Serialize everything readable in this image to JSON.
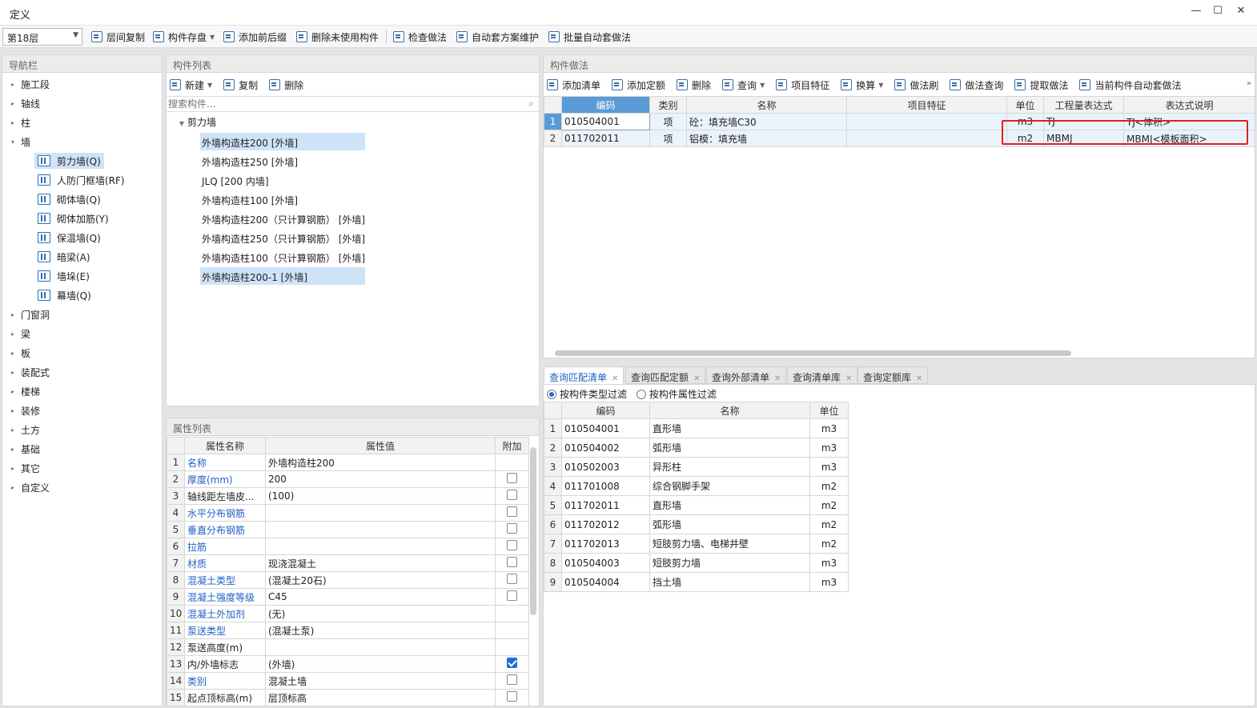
{
  "window": {
    "title": "定义",
    "min": "—",
    "max": "☐",
    "close": "✕"
  },
  "toolbar": {
    "floor": "第18层",
    "buttons": [
      "层间复制",
      "构件存盘",
      "添加前后缀",
      "删除未使用构件",
      "检查做法",
      "自动套方案维护",
      "批量自动套做法"
    ]
  },
  "nav": {
    "title": "导航栏",
    "items": [
      {
        "label": "施工段",
        "level": 0,
        "open": false
      },
      {
        "label": "轴线",
        "level": 0,
        "open": false
      },
      {
        "label": "柱",
        "level": 0,
        "open": false
      },
      {
        "label": "墙",
        "level": 0,
        "open": true
      },
      {
        "label": "剪力墙(Q)",
        "level": 1,
        "icon": "shear-wall-icon"
      },
      {
        "label": "人防门框墙(RF)",
        "level": 1,
        "icon": "door-frame-wall-icon"
      },
      {
        "label": "砌体墙(Q)",
        "level": 1,
        "icon": "masonry-wall-icon"
      },
      {
        "label": "砌体加筋(Y)",
        "level": 1,
        "icon": "masonry-rebar-icon"
      },
      {
        "label": "保温墙(Q)",
        "level": 1,
        "icon": "insulation-wall-icon"
      },
      {
        "label": "暗梁(A)",
        "level": 1,
        "icon": "hidden-beam-icon"
      },
      {
        "label": "墙垛(E)",
        "level": 1,
        "icon": "wall-pier-icon"
      },
      {
        "label": "幕墙(Q)",
        "level": 1,
        "icon": "curtain-wall-icon"
      },
      {
        "label": "门窗洞",
        "level": 0,
        "open": false
      },
      {
        "label": "梁",
        "level": 0,
        "open": false
      },
      {
        "label": "板",
        "level": 0,
        "open": false
      },
      {
        "label": "装配式",
        "level": 0,
        "open": false
      },
      {
        "label": "楼梯",
        "level": 0,
        "open": false
      },
      {
        "label": "装修",
        "level": 0,
        "open": false
      },
      {
        "label": "土方",
        "level": 0,
        "open": false
      },
      {
        "label": "基础",
        "level": 0,
        "open": false
      },
      {
        "label": "其它",
        "level": 0,
        "open": false
      },
      {
        "label": "自定义",
        "level": 0,
        "open": false
      }
    ]
  },
  "complist": {
    "title": "构件列表",
    "new": "新建",
    "copy": "复制",
    "delete": "删除",
    "search_placeholder": "搜索构件...",
    "group": "剪力墙",
    "items": [
      "外墙构造柱200 [外墙]",
      "外墙构造柱250 [外墙]",
      "JLQ [200 内墙]",
      "外墙构造柱100 [外墙]",
      "外墙构造柱200（只计算钢筋） [外墙]",
      "外墙构造柱250（只计算钢筋） [外墙]",
      "外墙构造柱100（只计算钢筋） [外墙]",
      "外墙构造柱200-1 [外墙]"
    ]
  },
  "props": {
    "title": "属性列表",
    "headers": [
      "属性名称",
      "属性值",
      "附加"
    ],
    "rows": [
      {
        "n": "1",
        "name": "名称",
        "val": "外墙构造柱200",
        "blue": true,
        "cb": null
      },
      {
        "n": "2",
        "name": "厚度(mm)",
        "val": "200",
        "blue": true,
        "cb": false
      },
      {
        "n": "3",
        "name": "轴线距左墙皮...",
        "val": "(100)",
        "blue": false,
        "cb": false
      },
      {
        "n": "4",
        "name": "水平分布钢筋",
        "val": "",
        "blue": true,
        "cb": false
      },
      {
        "n": "5",
        "name": "垂直分布钢筋",
        "val": "",
        "blue": true,
        "cb": false
      },
      {
        "n": "6",
        "name": "拉筋",
        "val": "",
        "blue": true,
        "cb": false
      },
      {
        "n": "7",
        "name": "材质",
        "val": "现浇混凝土",
        "blue": true,
        "cb": false
      },
      {
        "n": "8",
        "name": "混凝土类型",
        "val": "(混凝土20石)",
        "blue": true,
        "cb": false
      },
      {
        "n": "9",
        "name": "混凝土强度等级",
        "val": "C45",
        "blue": true,
        "cb": false
      },
      {
        "n": "10",
        "name": "混凝土外加剂",
        "val": "(无)",
        "blue": true,
        "cb": null
      },
      {
        "n": "11",
        "name": "泵送类型",
        "val": "(混凝土泵)",
        "blue": true,
        "cb": null
      },
      {
        "n": "12",
        "name": "泵送高度(m)",
        "val": "",
        "blue": false,
        "cb": null
      },
      {
        "n": "13",
        "name": "内/外墙标志",
        "val": "(外墙)",
        "blue": false,
        "cb": true
      },
      {
        "n": "14",
        "name": "类别",
        "val": "混凝土墙",
        "blue": true,
        "cb": false
      },
      {
        "n": "15",
        "name": "起点顶标高(m)",
        "val": "层顶标高",
        "blue": false,
        "cb": false
      }
    ]
  },
  "method": {
    "title": "构件做法",
    "tools": [
      "添加清单",
      "添加定额",
      "删除",
      "查询",
      "项目特征",
      "换算",
      "做法刷",
      "做法查询",
      "提取做法",
      "当前构件自动套做法"
    ],
    "headers": [
      "编码",
      "类别",
      "名称",
      "项目特征",
      "单位",
      "工程量表达式",
      "表达式说明"
    ],
    "rows": [
      {
        "n": "1",
        "code": "010504001",
        "cat": "项",
        "name": "砼：填充墙C30",
        "feat": "",
        "unit": "m3",
        "expr": "TJ",
        "desc": "TJ<体积>"
      },
      {
        "n": "2",
        "code": "011702011",
        "cat": "项",
        "name": "铝模：填充墙",
        "feat": "",
        "unit": "m2",
        "expr": "MBMJ",
        "desc": "MBMJ<模板面积>"
      }
    ]
  },
  "tabs": [
    "查询匹配清单",
    "查询匹配定额",
    "查询外部清单",
    "查询清单库",
    "查询定额库"
  ],
  "filter": {
    "opt1": "按构件类型过滤",
    "opt2": "按构件属性过滤"
  },
  "match": {
    "headers": [
      "编码",
      "名称",
      "单位"
    ],
    "rows": [
      {
        "n": "1",
        "code": "010504001",
        "name": "直形墙",
        "unit": "m3"
      },
      {
        "n": "2",
        "code": "010504002",
        "name": "弧形墙",
        "unit": "m3"
      },
      {
        "n": "3",
        "code": "010502003",
        "name": "异形柱",
        "unit": "m3"
      },
      {
        "n": "4",
        "code": "011701008",
        "name": "综合钢脚手架",
        "unit": "m2"
      },
      {
        "n": "5",
        "code": "011702011",
        "name": "直形墙",
        "unit": "m2"
      },
      {
        "n": "6",
        "code": "011702012",
        "name": "弧形墙",
        "unit": "m2"
      },
      {
        "n": "7",
        "code": "011702013",
        "name": "短肢剪力墙、电梯井壁",
        "unit": "m2"
      },
      {
        "n": "8",
        "code": "010504003",
        "name": "短肢剪力墙",
        "unit": "m3"
      },
      {
        "n": "9",
        "code": "010504004",
        "name": "挡土墙",
        "unit": "m3"
      }
    ]
  }
}
